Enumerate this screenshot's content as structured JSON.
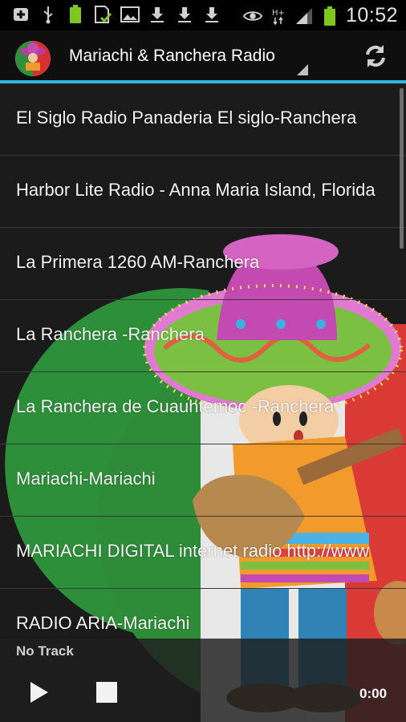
{
  "status_bar": {
    "time": "10:52",
    "icons": [
      "add-box-icon",
      "usb-icon",
      "battery-full-icon",
      "sd-card-check-icon",
      "image-icon",
      "download-icon",
      "download-icon",
      "download-icon",
      "eye-icon",
      "hplus-signal-icon",
      "signal-bars-icon",
      "battery-icon"
    ]
  },
  "action_bar": {
    "title": "Mariachi & Ranchera Radio",
    "accent_color": "#33b5e5"
  },
  "stations": [
    {
      "label": "El Siglo Radio Panaderia El siglo-Ranchera"
    },
    {
      "label": "Harbor Lite Radio - Anna Maria Island, Florida"
    },
    {
      "label": "La Primera 1260 AM-Ranchera"
    },
    {
      "label": "La Ranchera -Ranchera"
    },
    {
      "label": "La Ranchera de Cuauhtemoc -Ranchera"
    },
    {
      "label": "Mariachi-Mariachi"
    },
    {
      "label": "MARIACHI DIGITAL internet radio http://www"
    },
    {
      "label": "RADIO ARIA-Mariachi"
    }
  ],
  "player": {
    "track": "No Track",
    "time": "0:00"
  }
}
